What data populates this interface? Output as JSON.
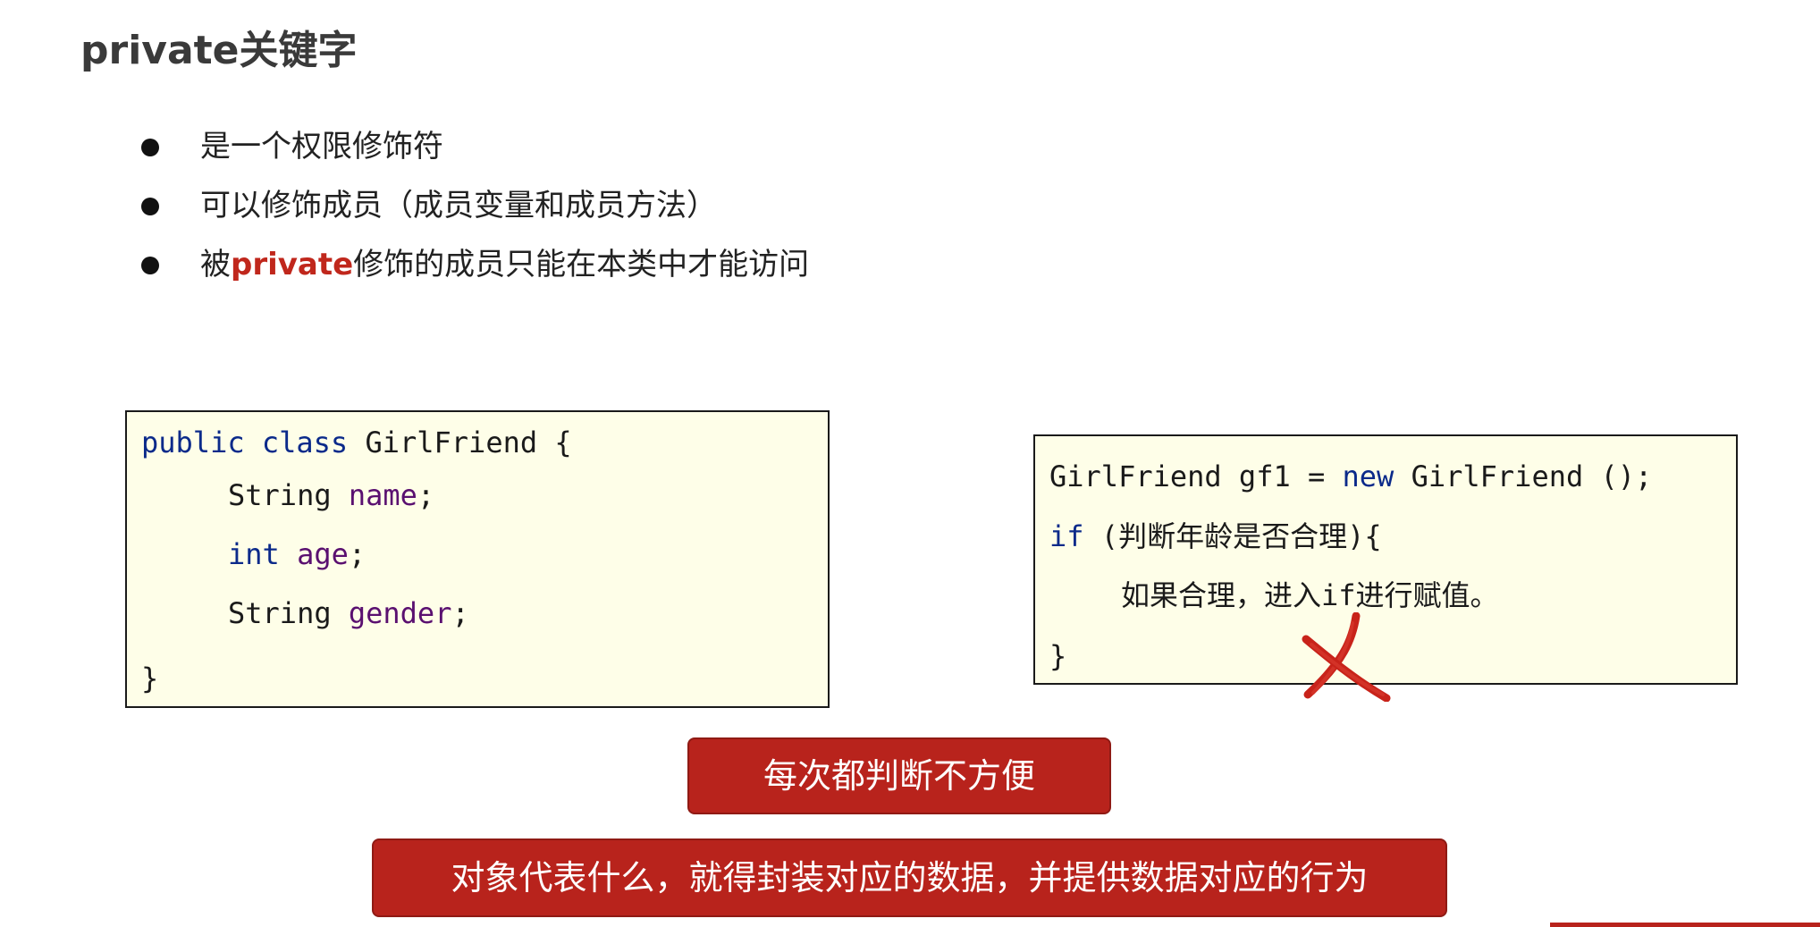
{
  "slide": {
    "title": "private关键字",
    "bullets": [
      {
        "text": "是一个权限修饰符"
      },
      {
        "text": "可以修饰成员（成员变量和成员方法）"
      },
      {
        "prefix": "被",
        "highlight": "private",
        "suffix": "修饰的成员只能在本类中才能访问"
      }
    ],
    "code_left": {
      "line1": {
        "kw1": "public",
        "kw2": "class",
        "rest": " GirlFriend {"
      },
      "line2": {
        "type": "String",
        "name": "name",
        "end": ";"
      },
      "line3": {
        "type": "int",
        "name": "age",
        "end": ";"
      },
      "line4": {
        "type": "String",
        "name": "gender",
        "end": ";"
      },
      "line5": "}"
    },
    "code_right": {
      "line1": {
        "a": "GirlFriend gf1 = ",
        "kw": "new",
        "b": " GirlFriend ();"
      },
      "line2": {
        "kw": "if",
        "rest": " (判断年龄是否合理){"
      },
      "line3": "如果合理，进入if进行赋值。",
      "line4": "}"
    },
    "banner_small": "每次都判断不方便",
    "banner_large": "对象代表什么，就得封装对应的数据，并提供数据对应的行为"
  },
  "colors": {
    "accent": "#c0271c",
    "banner_bg": "#b8231c",
    "code_bg": "#fefee8",
    "keyword": "#0b2a8a",
    "field": "#5a1070"
  },
  "icons": {
    "cross": "cross-mark-icon",
    "bullet": "bullet-dot"
  }
}
